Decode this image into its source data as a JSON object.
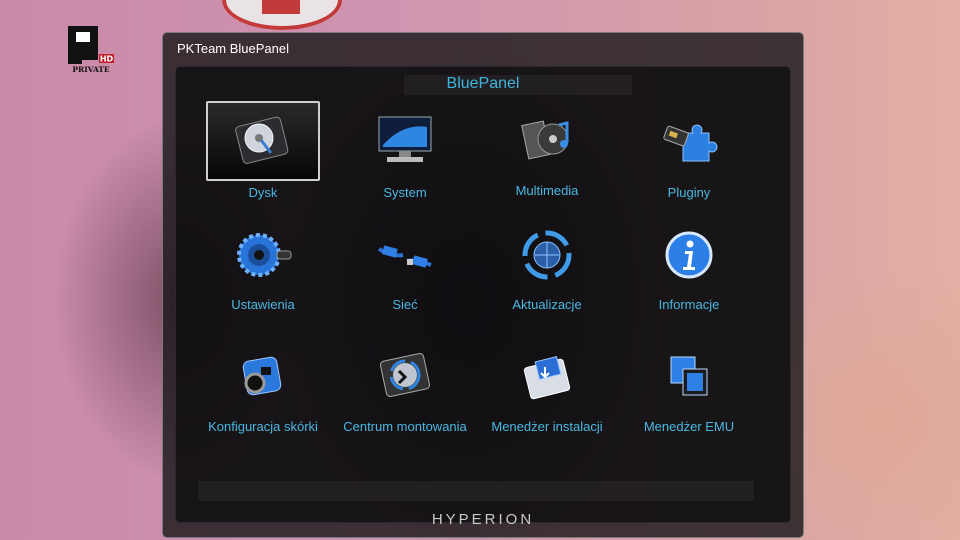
{
  "logo": {
    "letter": "P",
    "badge": "HD",
    "text": "PRIVATE"
  },
  "window": {
    "title": "PKTeam BluePanel"
  },
  "panel": {
    "title": "BluePanel",
    "brand": "HYPERION"
  },
  "menu": [
    {
      "label": "Dysk",
      "icon": "hard-disk-icon",
      "selected": true
    },
    {
      "label": "System",
      "icon": "monitor-icon"
    },
    {
      "label": "Multimedia",
      "icon": "multimedia-icon"
    },
    {
      "label": "Pluginy",
      "icon": "puzzle-plugin-icon"
    },
    {
      "label": "Ustawienia",
      "icon": "gear-icon"
    },
    {
      "label": "Sieć",
      "icon": "network-cable-icon"
    },
    {
      "label": "Aktualizacje",
      "icon": "update-globe-icon"
    },
    {
      "label": "Informacje",
      "icon": "info-icon"
    },
    {
      "label": "Konfiguracja skórki",
      "icon": "skin-config-icon"
    },
    {
      "label": "Centrum montowania",
      "icon": "mount-disk-icon"
    },
    {
      "label": "Menedżer instalacji",
      "icon": "install-manager-icon"
    },
    {
      "label": "Menedżer EMU",
      "icon": "emu-manager-icon"
    }
  ],
  "colors": {
    "accent": "#3fb4dd",
    "label": "#49b8e2",
    "selected_border": "#cfcfcf"
  }
}
